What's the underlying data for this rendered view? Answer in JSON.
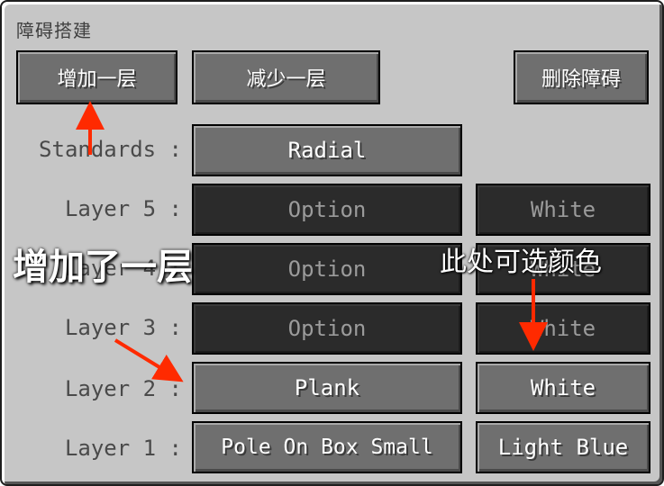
{
  "panel": {
    "title": "障碍搭建",
    "add_layer_button": "增加一层",
    "remove_layer_button": "减少一层",
    "delete_obstacle_button": "删除障碍"
  },
  "rows": {
    "standards": {
      "label": "Standards :",
      "value": "Radial"
    },
    "layer5": {
      "label": "Layer 5 :",
      "option": "Option",
      "color": "White"
    },
    "layer4": {
      "label": "Layer 4 :",
      "option": "Option",
      "color": "White"
    },
    "layer3": {
      "label": "Layer 3 :",
      "option": "Option",
      "color": "White"
    },
    "layer2": {
      "label": "Layer 2 :",
      "option": "Plank",
      "color": "White"
    },
    "layer1": {
      "label": "Layer 1 :",
      "option": "Pole On Box Small",
      "color": "Light Blue"
    }
  },
  "annotations": {
    "added_layer": "增加了一层",
    "choose_color_here": "此处可选颜色",
    "arrow_color": "#ff2a00"
  }
}
